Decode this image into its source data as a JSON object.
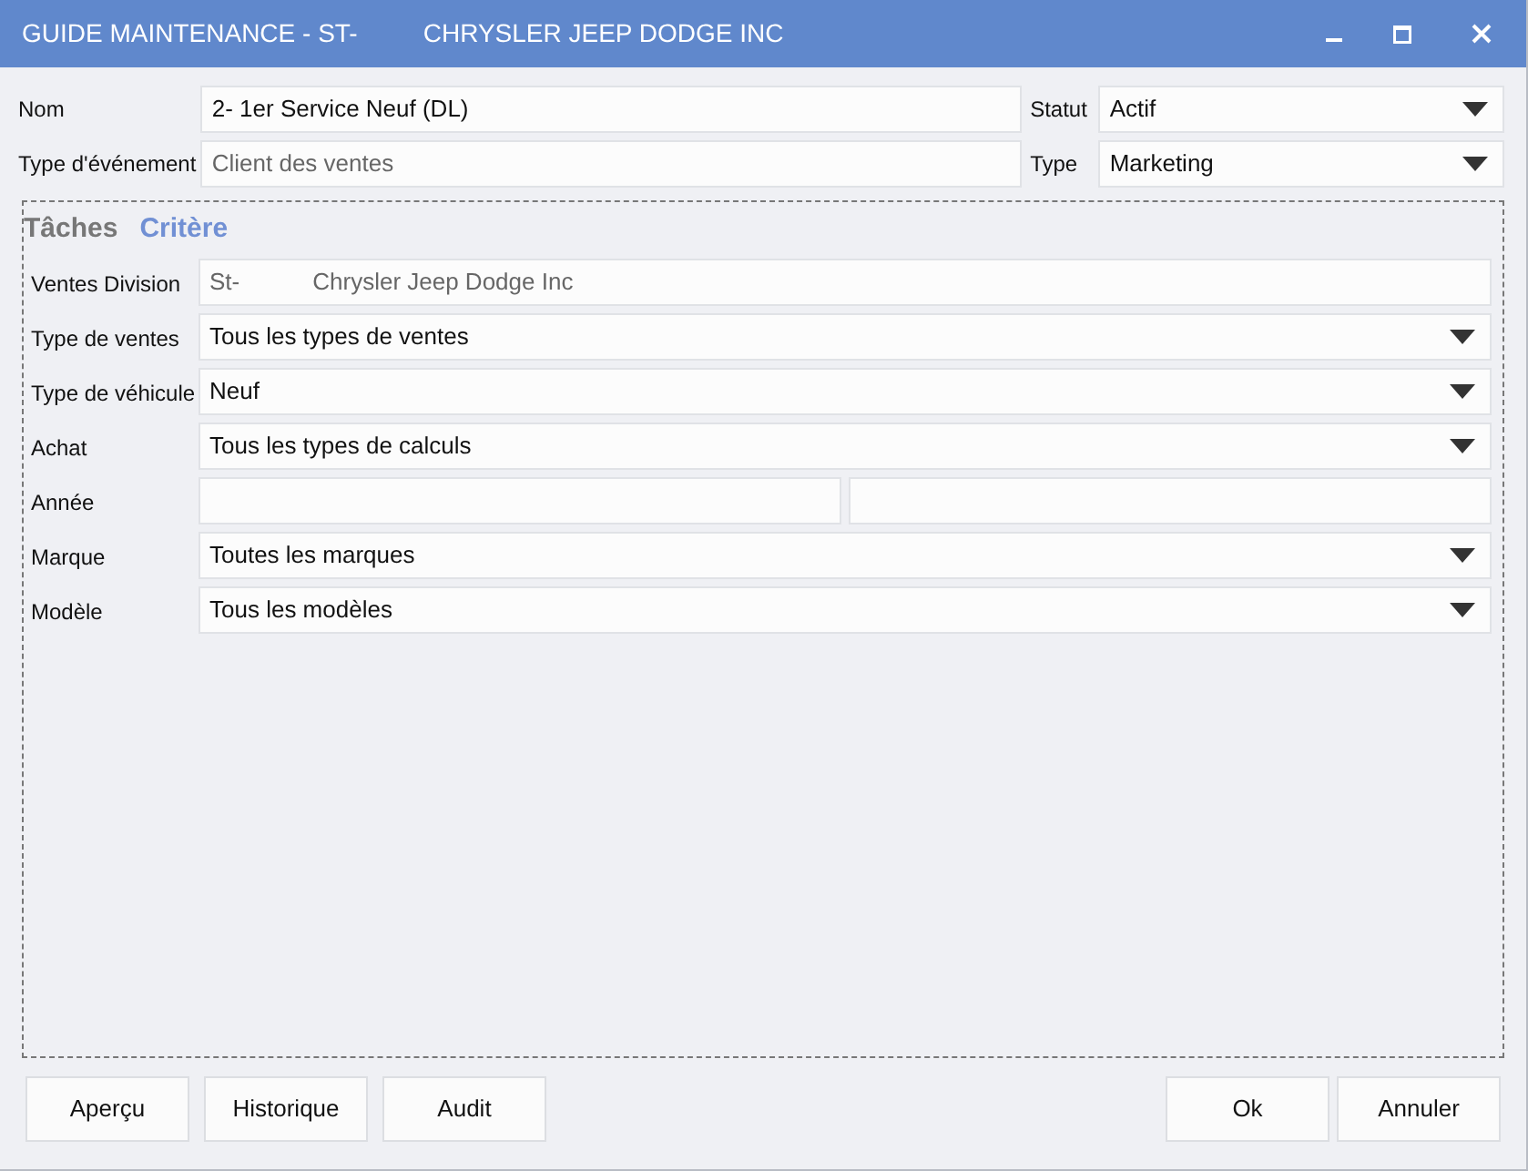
{
  "window": {
    "title_parts": [
      "GUIDE MAINTENANCE - ST-",
      "CHRYSLER JEEP DODGE INC"
    ]
  },
  "header_fields": [
    {
      "label": "Nom",
      "kind": "text",
      "value": "2- 1er Service Neuf (DL)",
      "side": {
        "label": "Statut",
        "kind": "dropdown",
        "value": "Actif"
      }
    },
    {
      "label": "Type d'événement",
      "kind": "readonly",
      "value": "Client des ventes",
      "side": {
        "label": "Type",
        "kind": "dropdown",
        "value": "Marketing"
      }
    }
  ],
  "tabs": [
    {
      "label": "Tâches",
      "selected": false
    },
    {
      "label": "Critère",
      "selected": true
    }
  ],
  "criteria": [
    {
      "label": "Ventes Division",
      "kind": "readonly",
      "value_parts": [
        "St-",
        "Chrysler Jeep Dodge Inc"
      ]
    },
    {
      "label": "Type de ventes",
      "kind": "dropdown",
      "value": "Tous les types de ventes"
    },
    {
      "label": "Type de véhicule",
      "kind": "dropdown",
      "value": "Neuf"
    },
    {
      "label": "Achat",
      "kind": "dropdown",
      "value": "Tous les types de calculs"
    },
    {
      "label": "Année",
      "kind": "range"
    },
    {
      "label": "Marque",
      "kind": "dropdown",
      "value": "Toutes les marques"
    },
    {
      "label": "Modèle",
      "kind": "dropdown",
      "value": "Tous les modèles"
    }
  ],
  "left_buttons": [
    "Aperçu",
    "Historique",
    "Audit"
  ],
  "right_buttons": [
    "Ok",
    "Annuler"
  ]
}
